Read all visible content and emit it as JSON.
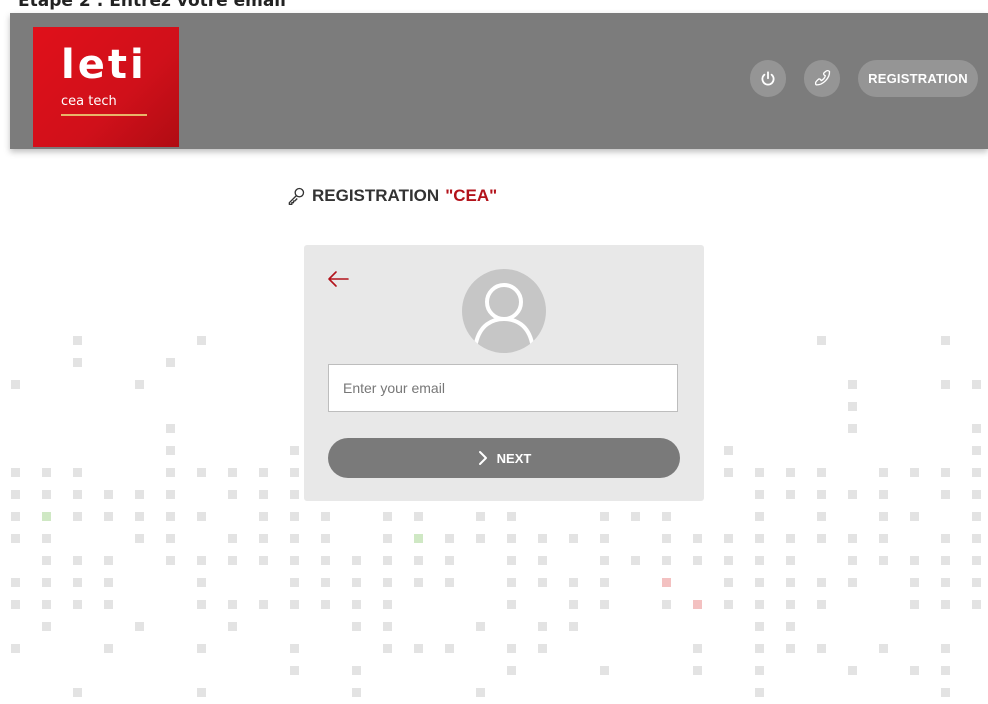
{
  "caption": "Etape 2 : Entrez votre email",
  "logo": {
    "main": "leti",
    "sub": "cea tech"
  },
  "header": {
    "power_icon": "power-icon",
    "phone_icon": "phone-icon",
    "registration_label": "REGISTRATION"
  },
  "title": {
    "prefix": "REGISTRATION",
    "quoted": "\"CEA\"",
    "icon": "key-icon"
  },
  "form": {
    "back_icon": "arrow-left-icon",
    "avatar_icon": "user-icon",
    "email_placeholder": "Enter your email",
    "email_value": "",
    "next_label": "NEXT",
    "next_icon": "chevron-right-icon"
  },
  "colors": {
    "header_bg": "#7c7c7c",
    "brand_red": "#e0101a",
    "accent_red": "#b3131b",
    "card_bg": "#e8e8e8",
    "button_bg": "#7a7a7a"
  }
}
